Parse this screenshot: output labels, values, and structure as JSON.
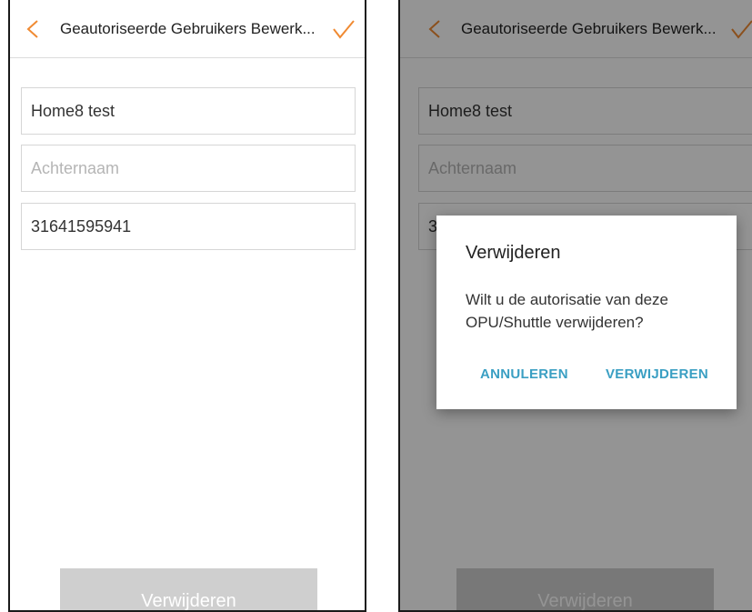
{
  "colors": {
    "accent": "#f08a32",
    "dialog_button": "#3a9fc3",
    "delete_button_bg": "#cfcfcf"
  },
  "screens": [
    {
      "header": {
        "title": "Geautoriseerde Gebruikers Bewerk...",
        "back_icon": "chevron-left-icon",
        "confirm_icon": "checkmark-icon"
      },
      "form": {
        "first_name_value": "Home8 test",
        "last_name_placeholder": "Achternaam",
        "phone_value": "31641595941"
      },
      "delete_button_label": "Verwijderen"
    },
    {
      "header": {
        "title": "Geautoriseerde Gebruikers Bewerk...",
        "back_icon": "chevron-left-icon",
        "confirm_icon": "checkmark-icon"
      },
      "form": {
        "first_name_value": "Home8 test",
        "last_name_placeholder": "Achternaam",
        "phone_value": "31641595941"
      },
      "delete_button_label": "Verwijderen",
      "dialog": {
        "title": "Verwijderen",
        "message": "Wilt u de autorisatie van deze OPU/Shuttle verwijderen?",
        "cancel_label": "ANNULEREN",
        "confirm_label": "VERWIJDEREN"
      }
    }
  ]
}
